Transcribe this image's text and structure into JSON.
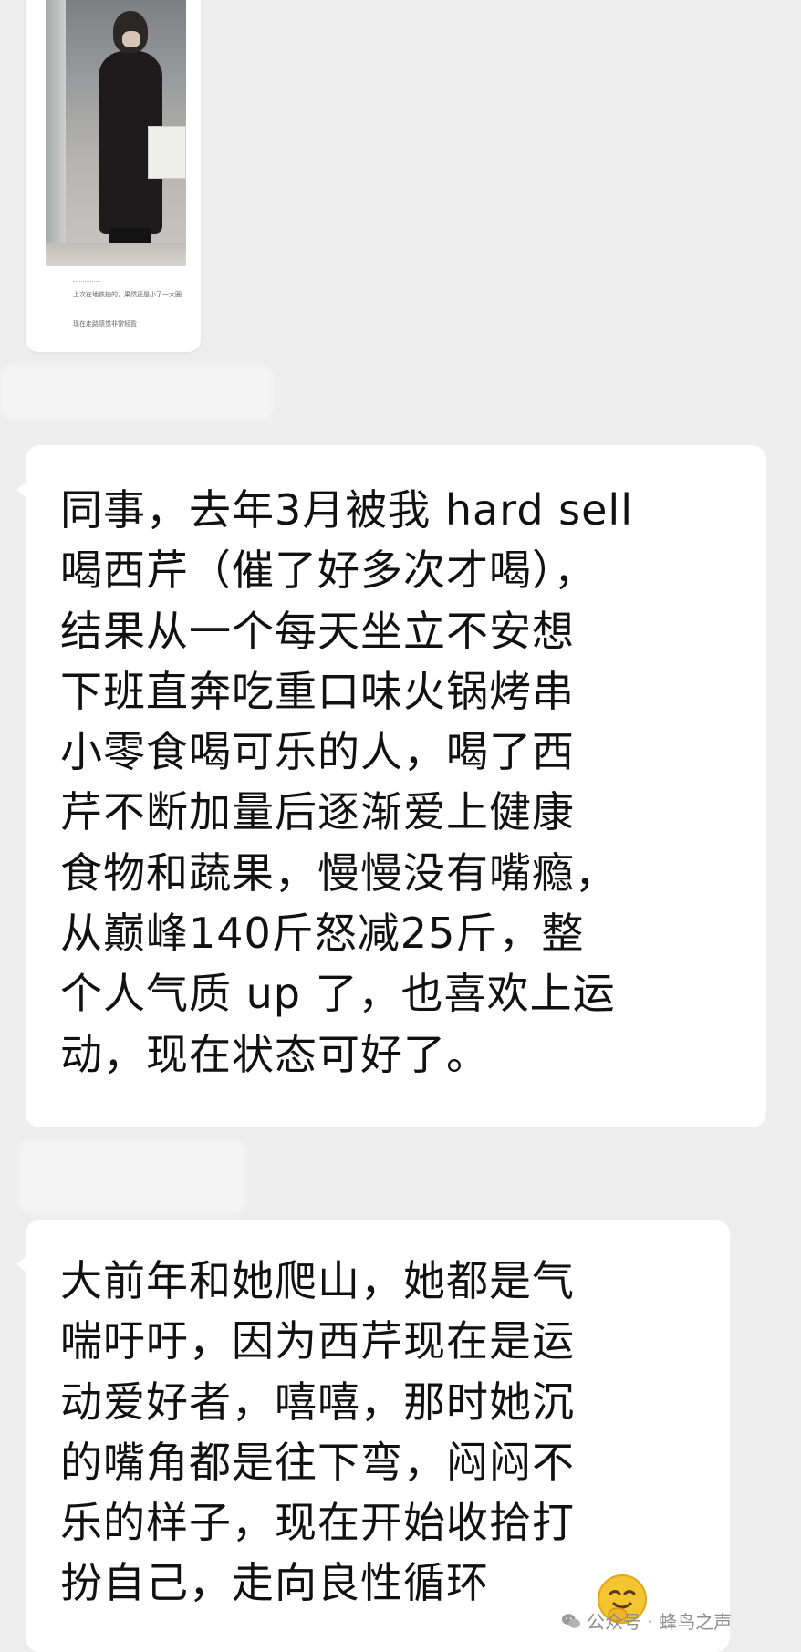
{
  "image_message": {
    "caption_line_1": "上次在地铁拍的，果然还是小了一大圈",
    "caption_line_2": "现在走路感觉非常轻盈"
  },
  "messages": [
    {
      "lines": [
        "同事，去年3月被我 hard sell",
        "喝西芹（催了好多次才喝），",
        "结果从一个每天坐立不安想",
        "下班直奔吃重口味火锅烤串",
        "小零食喝可乐的人，喝了西",
        "芹不断加量后逐渐爱上健康",
        "食物和蔬果，慢慢没有嘴瘾，",
        "从巅峰140斤怒减25斤，整",
        "个人气质 up 了，也喜欢上运",
        "动，现在状态可好了。"
      ]
    },
    {
      "lines": [
        "大前年和她爬山，她都是气",
        "喘吁吁，因为西芹现在是运",
        "动爱好者，嘻嘻，那时她沉",
        "的嘴角都是往下弯，闷闷不",
        "乐的样子，现在开始收拾打",
        "扮自己，走向良性循环"
      ],
      "trailing_emoji": "shy-smile-emoji"
    }
  ],
  "watermark": {
    "text": "公众号 · 蜂鸟之声",
    "icon": "wechat-icon"
  },
  "colors": {
    "background": "#ededed",
    "bubble": "#ffffff",
    "text": "#111111",
    "watermark": "#8f8f8f",
    "emoji": "#f5c531"
  }
}
